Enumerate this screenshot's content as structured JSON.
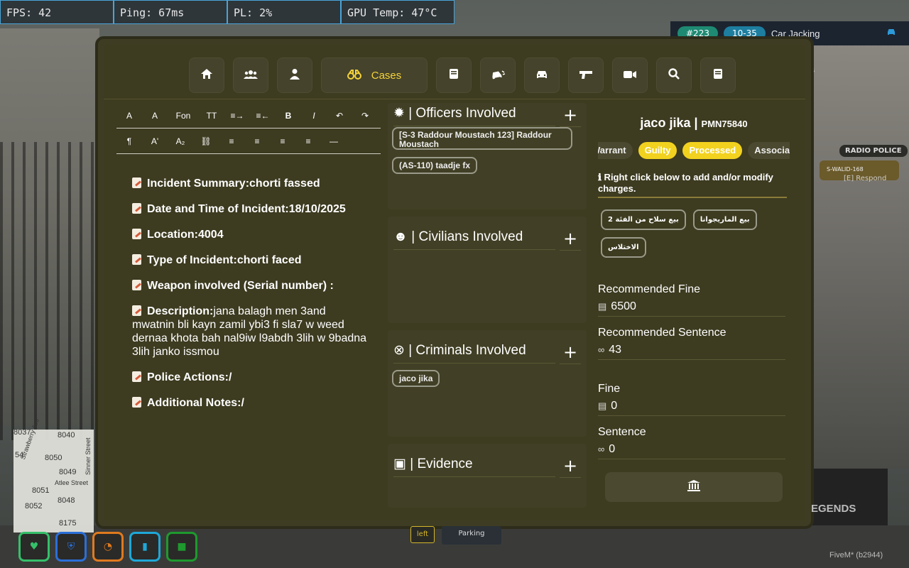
{
  "stats": {
    "fps": "FPS: 42",
    "ping": "Ping: 67ms",
    "pl": "PL: 2%",
    "gpu": "GPU Temp: 47°C"
  },
  "dispatch": {
    "code": "#223",
    "ten_code": "10-35",
    "title": "Car Jacking",
    "sub": "s"
  },
  "radio": {
    "tag": "RADIO POLICE",
    "card": "S-WALID-168",
    "respond": "[E] Respond"
  },
  "nav": {
    "active_label": "Cases"
  },
  "editor": {
    "toolbar_row1": [
      "A",
      "A",
      "Fon",
      "TT",
      "≡→",
      "≡←",
      "B",
      "I",
      "↶",
      "↷"
    ],
    "toolbar_row2": [
      "¶",
      "A'",
      "A₂",
      "🔗",
      "≡",
      "≡",
      "≡",
      "≡",
      "—"
    ],
    "lines": [
      {
        "label": "Incident Summary:",
        "value": "chorti fassed"
      },
      {
        "label": "Date and Time of Incident:",
        "value": "18/10/2025"
      },
      {
        "label": "Location:",
        "value": "4004"
      },
      {
        "label": "Type of Incident:",
        "value": "chorti faced"
      },
      {
        "label": "Weapon involved (Serial number) :",
        "value": ""
      },
      {
        "label": "Description:",
        "value": "jana balagh men 3and mwatnin bli kayn zamil ybi3 fi sla7 w weed dernaa khota bah nal9iw l9abdh 3lih w 9badna 3lih janko issmou"
      },
      {
        "label": "Police Actions:",
        "value": "/"
      },
      {
        "label": "Additional Notes:",
        "value": "/"
      }
    ]
  },
  "sections": {
    "officers": {
      "title": "| Officers Involved",
      "tags": [
        "[S-3 Raddour Moustach 123] Raddour Moustach",
        "(AS-110) taadje fx"
      ]
    },
    "civilians": {
      "title": "| Civilians Involved",
      "tags": []
    },
    "criminals": {
      "title": "| Criminals Involved",
      "tags": [
        "jaco jika"
      ]
    },
    "evidence": {
      "title": "| Evidence",
      "tags": []
    }
  },
  "person": {
    "name": "jaco jika |",
    "id": "PMN75840",
    "badges": [
      "Warrant",
      "Guilty",
      "Processed",
      "Associates"
    ],
    "hint": "ℹ Right click below to add and/or modify charges.",
    "charges": [
      "بيع سلاح من الفئة 2",
      "بيع الماريجوانا",
      "الاختلاس"
    ],
    "recommended_fine_label": "Recommended Fine",
    "recommended_fine": "6500",
    "recommended_sentence_label": "Recommended Sentence",
    "recommended_sentence": "43",
    "fine_label": "Fine",
    "fine": "0",
    "sentence_label": "Sentence",
    "sentence": "0"
  },
  "map": {
    "labels": [
      "8037",
      "8040",
      "54",
      "8050",
      "8049",
      "8051",
      "8048",
      "8052",
      "8175",
      "Atlee Street",
      "Strawberry Ave",
      "Sinner Street"
    ]
  },
  "bottom": {
    "left_tag": "left",
    "parking": "Parking",
    "legends": "EGENDS",
    "fivem": "FiveM* (b2944)"
  },
  "colors": {
    "accent": "#f2d21e",
    "panel": "#3d3b20"
  }
}
